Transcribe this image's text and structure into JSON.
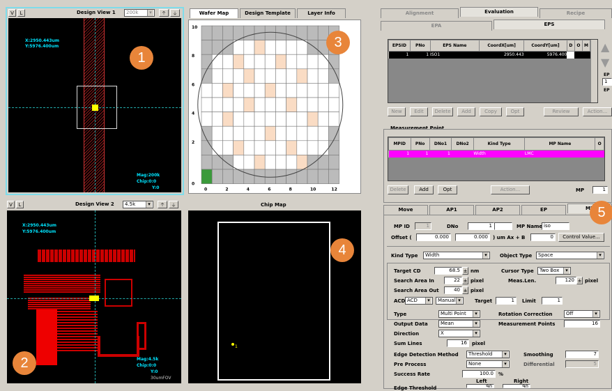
{
  "design_view_1": {
    "v": "V",
    "l": "L",
    "title": "Design View 1",
    "zoom": "200k",
    "xy": "X:2950.443um",
    "y": "Y:5976.400um",
    "mag": "Mag:200k",
    "chip": "Chip:0:0",
    "yy": "Y:0"
  },
  "design_view_2": {
    "v": "V",
    "l": "L",
    "title": "Design View 2",
    "zoom": "4.5k",
    "xy": "X:2950.443um",
    "y": "Y:5976.400um",
    "mag": "Mag:4.5k",
    "chip": "Chip:0:0",
    "yy": "Y:0",
    "fov": "30umFOV"
  },
  "wafer_tabs": [
    "Wafer Map",
    "Design Template",
    "Layer Info"
  ],
  "wafer_y_labels": [
    "10",
    "8",
    "6",
    "4",
    "2",
    "0"
  ],
  "wafer_x_labels": [
    "0",
    "2",
    "4",
    "6",
    "8",
    "10",
    "12"
  ],
  "chip_map": {
    "title": "Chip Map",
    "point_label": "1"
  },
  "badges": [
    "1",
    "2",
    "3",
    "4",
    "5"
  ],
  "top_tabs": [
    "Alignment",
    "Evaluation",
    "Recipe"
  ],
  "sub_tabs": [
    "EPA",
    "EPS"
  ],
  "eps_table": {
    "headers": [
      "EPSID",
      "PNo",
      "EPS Name",
      "CoordX[um]",
      "CoordY[um]",
      "D",
      "O",
      "M"
    ],
    "row": [
      "1",
      "1",
      "ISO1",
      "2950.443",
      "5976.400",
      "",
      "",
      ""
    ]
  },
  "eps_buttons": [
    "New",
    "Edit",
    "Delete",
    "Add",
    "Copy",
    "Opt",
    "Review",
    "Action..."
  ],
  "side_labels": [
    "EP",
    "1",
    "EP"
  ],
  "mp_section": {
    "title": "Measurement Point",
    "headers": [
      "MPID",
      "PNo",
      "DNo1",
      "DNo2",
      "Kind Type",
      "MP Name",
      "O"
    ],
    "row": [
      "1",
      "1",
      "1",
      "",
      "Width",
      "LMC",
      ""
    ],
    "buttons": [
      "Delete",
      "Add",
      "Opt",
      "Action..."
    ],
    "mp_label": "MP",
    "mp_value": "1"
  },
  "bottom_tabs": [
    "Move",
    "AP1",
    "AP2",
    "EP",
    "MP"
  ],
  "form": {
    "mpid_label": "MP ID",
    "mpid": "1",
    "dno_label": "DNo",
    "dno": "1",
    "mpname_label": "MP Name",
    "mpname": "iso",
    "offset_label": "Offset (",
    "offset_x": "0.000",
    "offset_y": "0.000",
    "offset_unit": ") um  Ax + B",
    "offset_b": "0",
    "control_btn": "Control Value...",
    "kind_label": "Kind Type",
    "kind": "Width",
    "object_label": "Object Type",
    "object": "Space",
    "target_cd_label": "Target CD",
    "target_cd": "68.5",
    "nm": "nm",
    "cursor_label": "Cursor Type",
    "cursor": "Two Box",
    "search_in_label": "Search Area In",
    "search_in": "22",
    "pixel": "pixel",
    "meas_len_label": "Meas.Len.",
    "meas_len": "120",
    "pixel2": "pixel",
    "search_out_label": "Search Area Out",
    "search_out": "40",
    "pixel3": "pixel",
    "acd_label": "ACD",
    "acd": "ACD",
    "manual": "Manual",
    "target_label": "Target",
    "target": "1",
    "limit_label": "Limit",
    "limit": "1",
    "type_label": "Type",
    "type": "Multi Point",
    "rot_label": "Rotation Correction",
    "rot": "Off",
    "output_label": "Output Data",
    "output": "Mean",
    "mpoints_label": "Measurement Points",
    "mpoints": "16",
    "direction_label": "Direction",
    "direction": "X",
    "sum_label": "Sum Lines",
    "sum": "16",
    "sum_unit": "pixel",
    "edge_label": "Edge Detection Method",
    "edge": "Threshold",
    "smooth_label": "Smoothing",
    "smooth": "7",
    "pre_label": "Pre Process",
    "pre": "None",
    "diff_label": "Differential",
    "diff": "5",
    "success_label": "Success Rate",
    "success": "100.0",
    "pct": "%",
    "left": "Left",
    "right": "Right",
    "edge_th_label": "Edge Threshold",
    "edge_l": "90",
    "edge_r": "90",
    "pct2": "%"
  }
}
